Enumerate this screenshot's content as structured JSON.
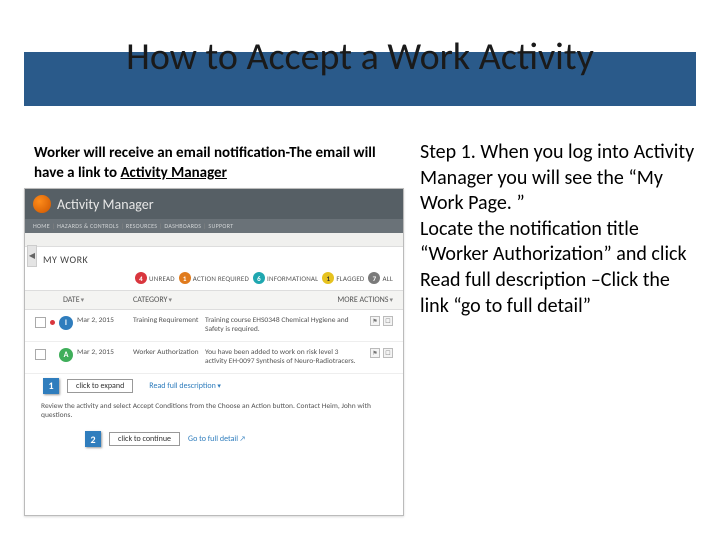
{
  "title": "How to Accept a Work Activity",
  "intro": {
    "line1": "Worker will receive an email notification-The email will have a link to ",
    "link": "Activity Manager"
  },
  "screenshot": {
    "app_name": "Activity Manager",
    "nav": [
      "HOME",
      "HAZARDS & CONTROLS",
      "RESOURCES",
      "DASHBOARDS",
      "SUPPORT"
    ],
    "mywork_label": "MY WORK",
    "filters": {
      "unread": {
        "n": "4",
        "label": "UNREAD"
      },
      "action": {
        "n": "1",
        "label": "ACTION REQUIRED"
      },
      "info": {
        "n": "6",
        "label": "INFORMATIONAL"
      },
      "flag": {
        "n": "1",
        "label": "FLAGGED"
      },
      "all": {
        "n": "7",
        "label": "ALL"
      }
    },
    "th": {
      "date": "DATE",
      "cat": "CATEGORY",
      "more": "MORE ACTIONS"
    },
    "rows": [
      {
        "avatar": "I",
        "avclass": "av-blue",
        "dot": "#d9363e",
        "date": "Mar 2, 2015",
        "cat": "Training Requirement",
        "desc": "Training course EHS0348 Chemical Hygiene and Safety is required."
      },
      {
        "avatar": "A",
        "avclass": "av-green",
        "dot": null,
        "date": "Mar 2, 2015",
        "cat": "Worker Authorization",
        "desc": "You have been added to work on risk level 3 activity EH-0097 Synthesis of Neuro-Radiotracers."
      }
    ],
    "expand": {
      "num": "1",
      "btn": "click to expand",
      "read": "Read full description"
    },
    "instruction": "Review the activity and select Accept Conditions from the Choose an Action button. Contact Heim, John with questions.",
    "cont": {
      "num": "2",
      "btn": "click to continue",
      "go": "Go to full detail"
    }
  },
  "step": "Step 1. When you log into Activity Manager you will see the “My Work Page. ”\nLocate the notification title “Worker Authorization” and click Read full description –Click the link “go to full detail”"
}
